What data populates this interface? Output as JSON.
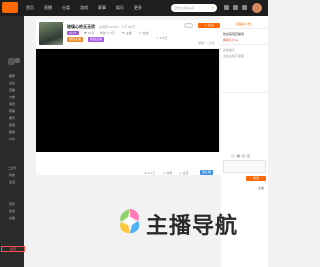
{
  "topbar": {
    "nav": [
      "首页",
      "直播",
      "分类",
      "游戏",
      "赛事",
      "娱乐",
      "更多"
    ],
    "search_placeholder": "搜索主播/房间",
    "icon_names": [
      "message-icon",
      "history-icon",
      "download-icon"
    ]
  },
  "sidebar": {
    "items": [
      "推荐",
      "关注",
      "直播",
      "分类",
      "游戏",
      "赛事",
      "娱乐",
      "颜值",
      "星秀",
      "户外",
      "二次元",
      "科技",
      "生活",
      "音乐",
      "综合",
      "主播",
      "招募"
    ],
    "active_label": "招募"
  },
  "room": {
    "title": "玻璃心的玉玉欣",
    "subtitle": "房间号 12345 · 人气 98万",
    "level_badge": "LV.21",
    "meta_1": "♥ 16万",
    "meta_2": "粉丝 2.3万",
    "meta_3": "⚑ 主播",
    "meta_4": "⊙ 在线",
    "meta_5": "☆ 5.6万",
    "tag_1": "游戏主播",
    "tag_2": "星级主播",
    "follow_label": "+ 关注",
    "report_label": "举报  ⚐ 分享"
  },
  "player": {
    "stat_1": "⊕ 4.1万",
    "stat_2": "≡ 弹幕",
    "stat_3": "◎ 设置",
    "gift_label": "送礼物"
  },
  "chat": {
    "head_label": "直播间公告",
    "lines": [
      "欢迎来到直播间",
      "弹幕礼仪 ▸",
      "系统提示",
      "关注主播不迷路"
    ],
    "tools": "☺ ▣ ▤ ▥",
    "send_label": "发送",
    "footer_label": "主播"
  },
  "watermark": {
    "text": "主播导航"
  },
  "colors": {
    "accent": "#ff6a00",
    "dark": "#1e1e1e",
    "panel": "#ffffff"
  }
}
